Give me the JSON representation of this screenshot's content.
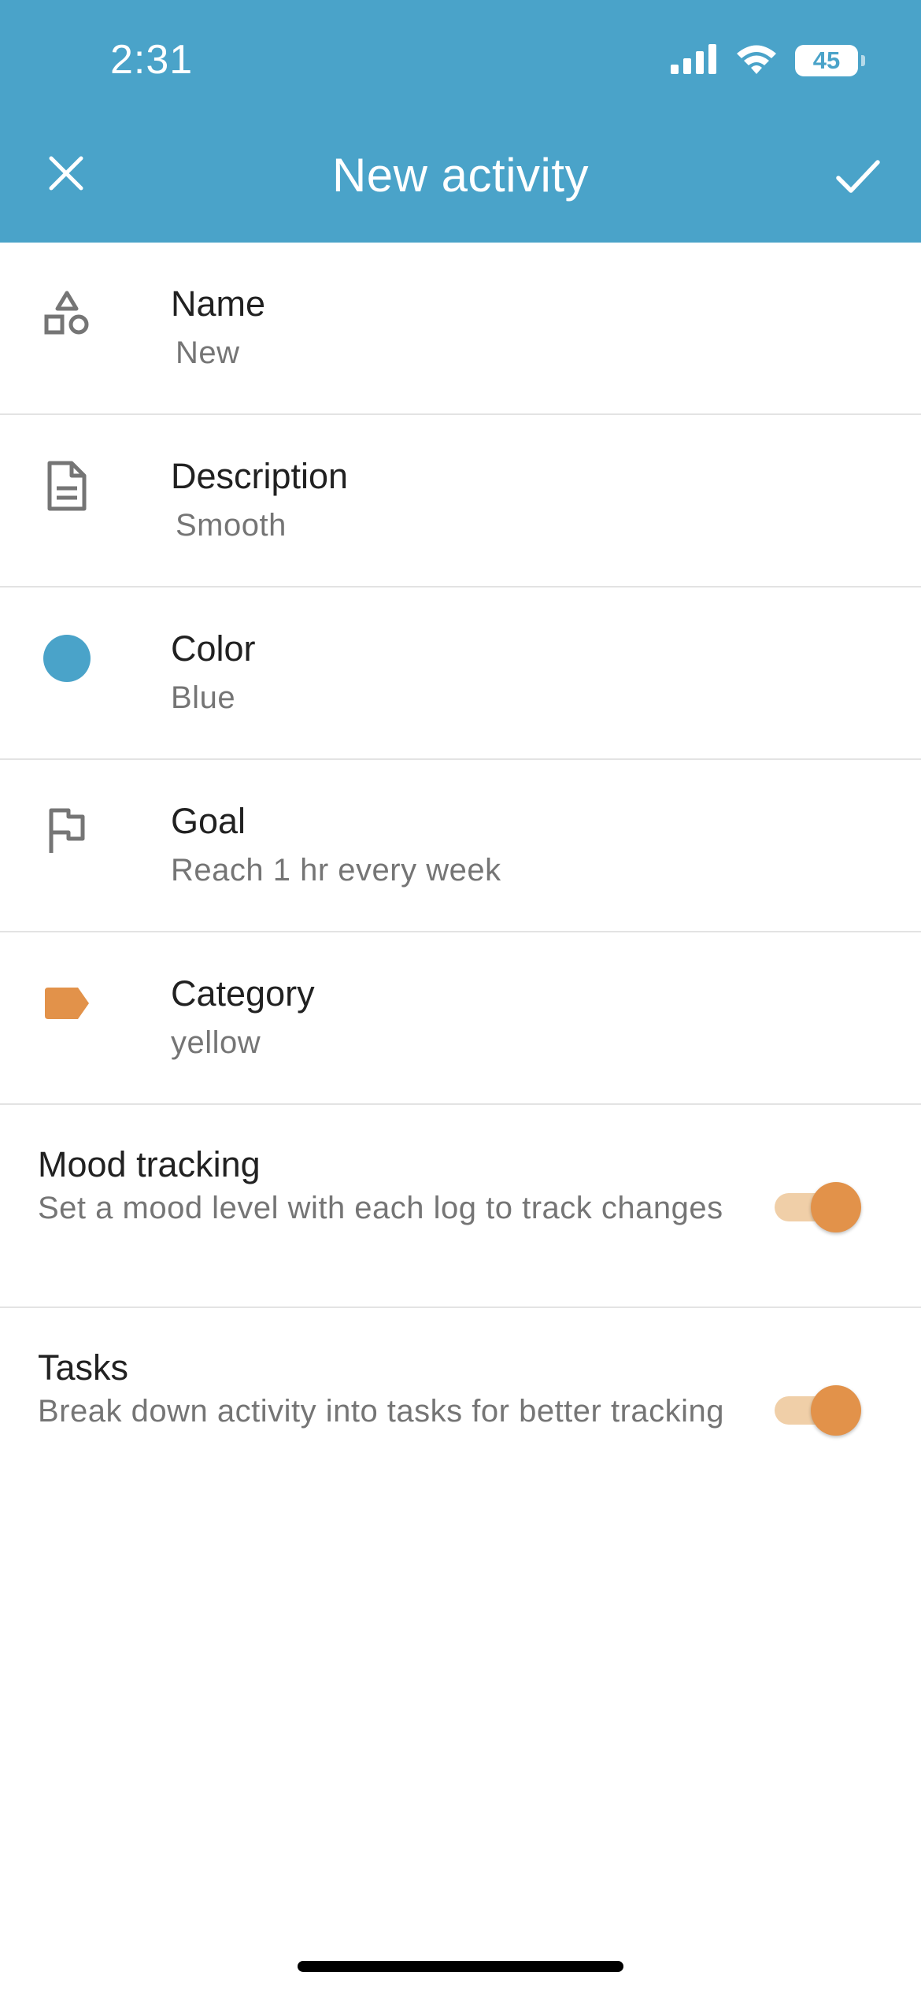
{
  "status_bar": {
    "time": "2:31",
    "battery_level": "45"
  },
  "header": {
    "title": "New activity",
    "background_color": "#4aa3c9"
  },
  "fields": {
    "name": {
      "label": "Name",
      "value": "New",
      "icon": "shapes-icon"
    },
    "description": {
      "label": "Description",
      "value": "Smooth",
      "icon": "document-icon"
    },
    "color": {
      "label": "Color",
      "value": "Blue",
      "icon": "color-dot-icon",
      "swatch": "#4aa3c9"
    },
    "goal": {
      "label": "Goal",
      "value": "Reach 1 hr every week",
      "icon": "flag-icon"
    },
    "category": {
      "label": "Category",
      "value": "yellow",
      "icon": "tag-icon",
      "swatch": "#e2924a"
    }
  },
  "toggles": {
    "mood_tracking": {
      "title": "Mood tracking",
      "description": "Set a mood level with each log to track changes",
      "enabled": true
    },
    "tasks": {
      "title": "Tasks",
      "description": "Break down activity into tasks for better tracking",
      "enabled": true
    }
  },
  "accent_color": "#e2924a"
}
